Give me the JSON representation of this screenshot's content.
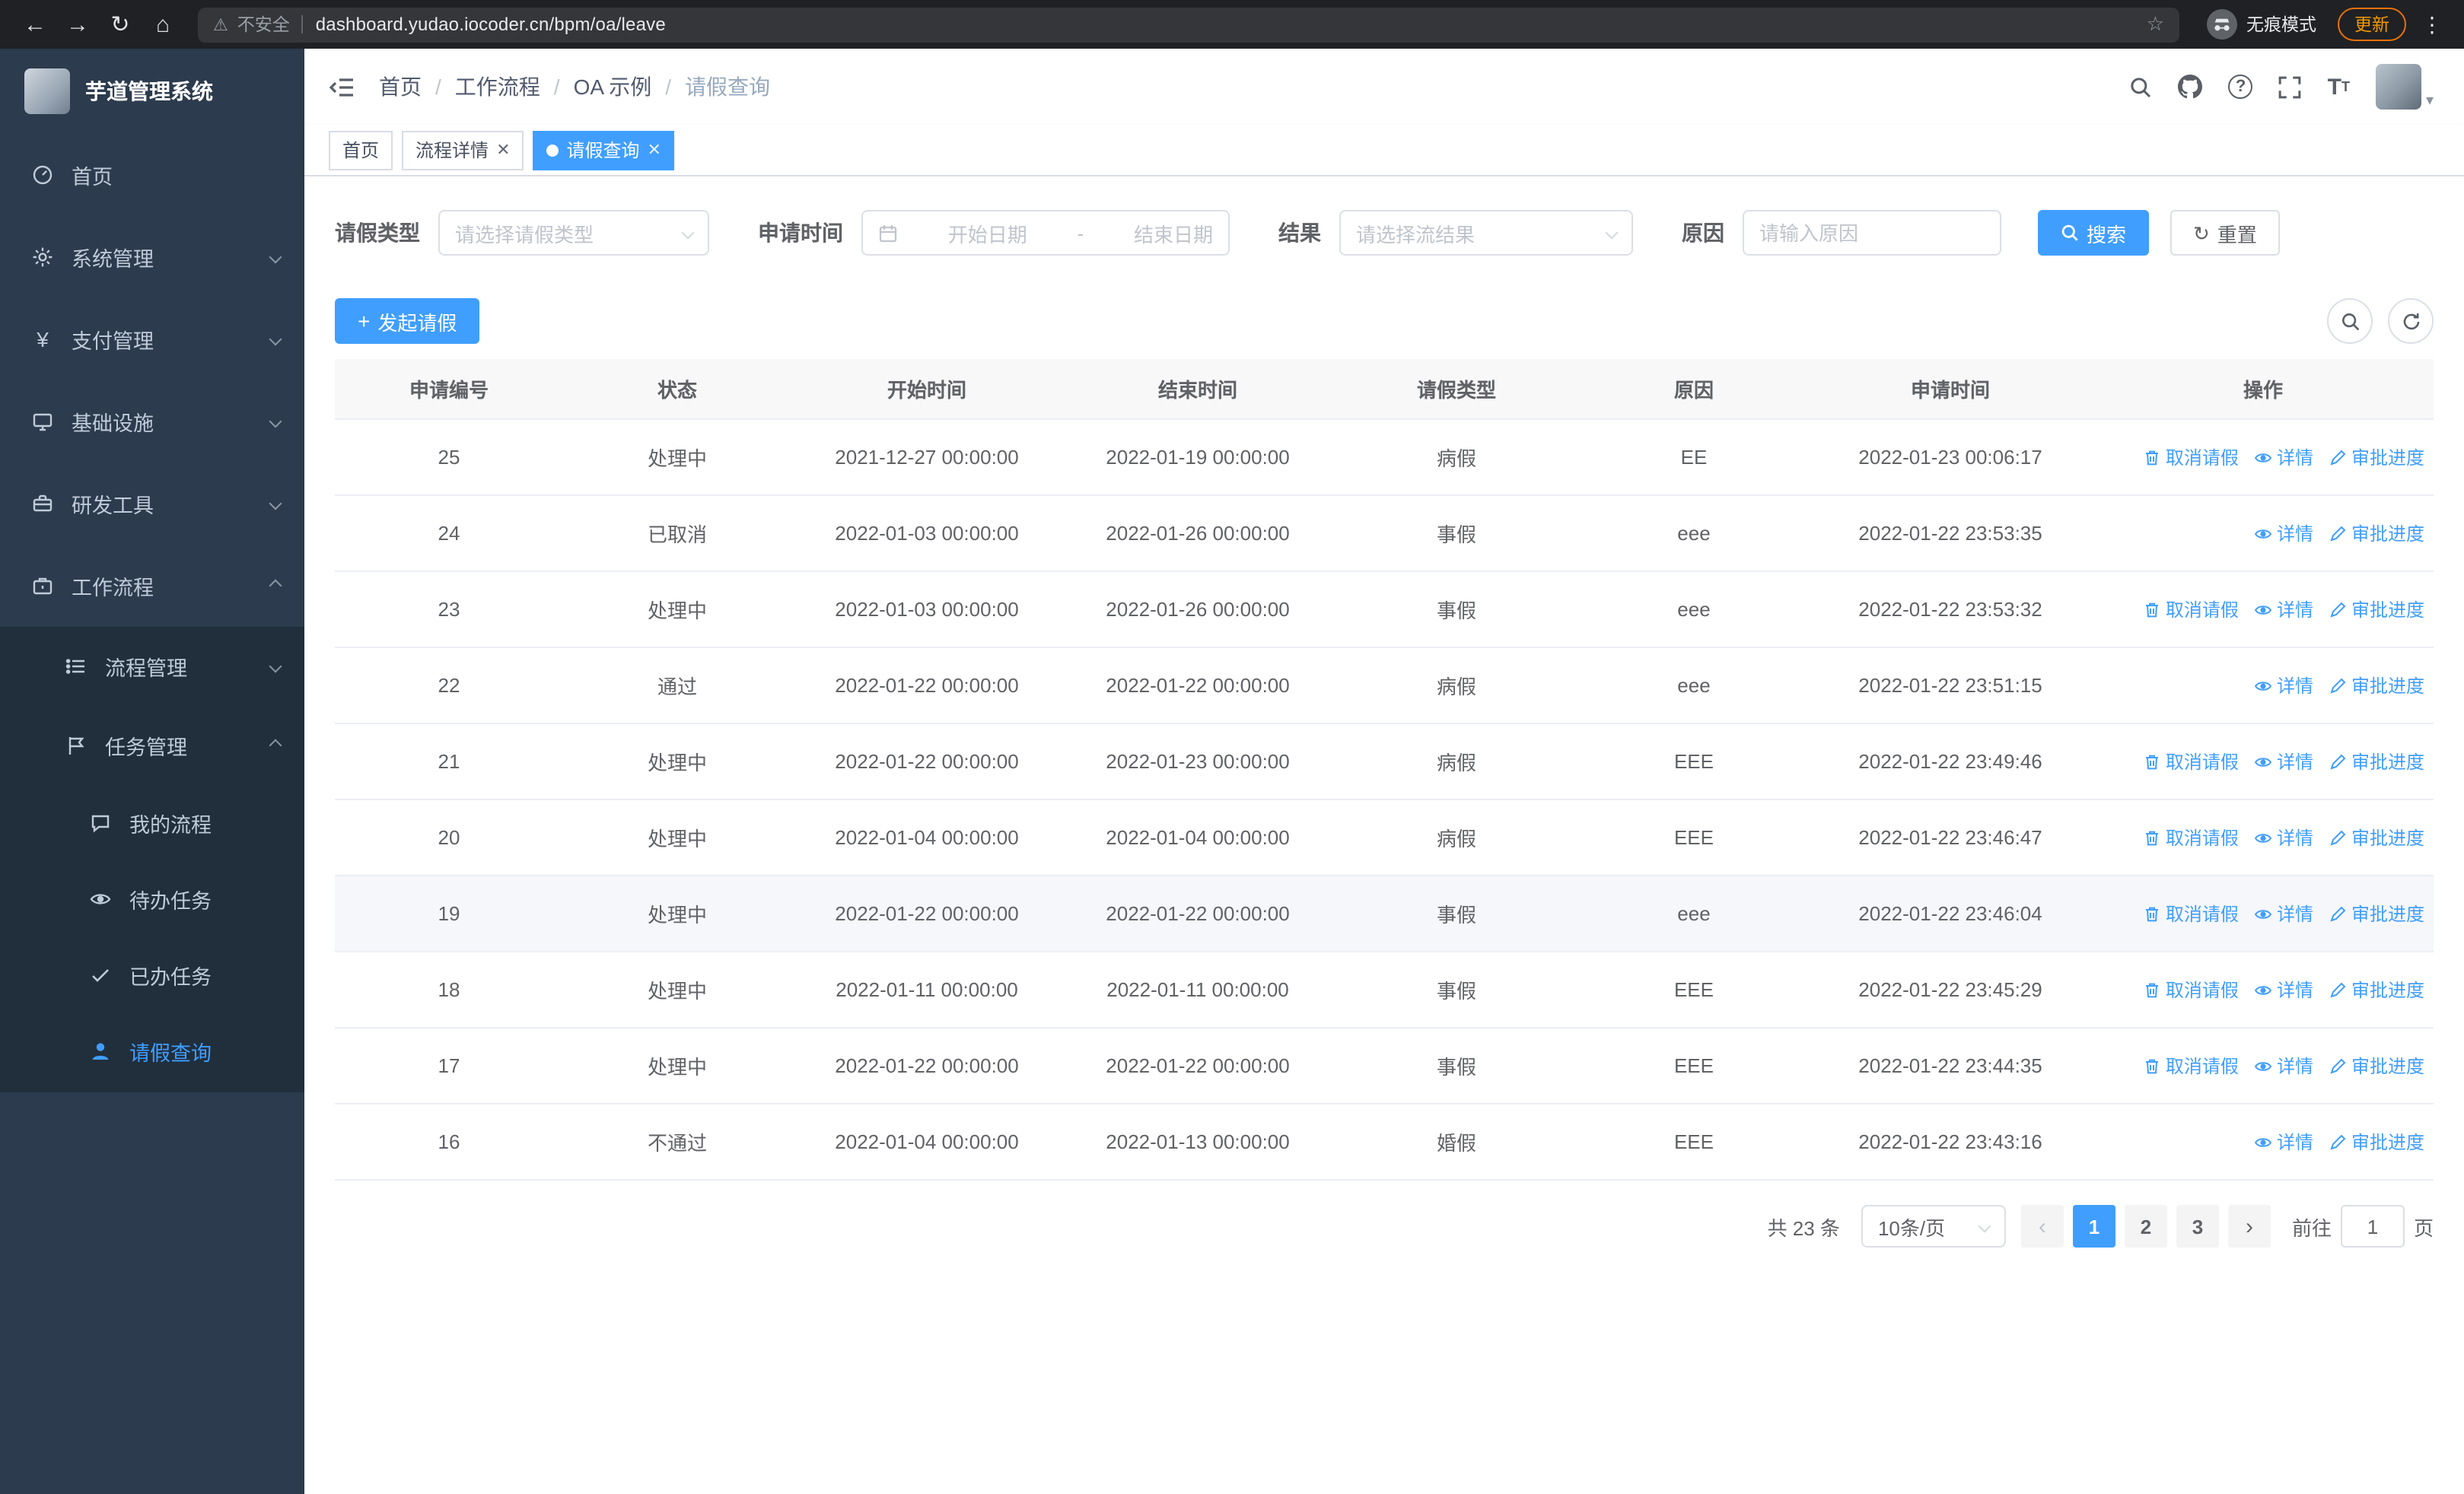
{
  "browser": {
    "security_label": "不安全",
    "url": "dashboard.yudao.iocoder.cn/bpm/oa/leave",
    "incognito_label": "无痕模式",
    "update_label": "更新"
  },
  "sidebar": {
    "logo_title": "芋道管理系统",
    "items": [
      {
        "label": "首页"
      },
      {
        "label": "系统管理"
      },
      {
        "label": "支付管理"
      },
      {
        "label": "基础设施"
      },
      {
        "label": "研发工具"
      },
      {
        "label": "工作流程"
      }
    ],
    "workflow_children": [
      {
        "label": "流程管理"
      },
      {
        "label": "任务管理"
      }
    ],
    "task_children": [
      {
        "label": "我的流程"
      },
      {
        "label": "待办任务"
      },
      {
        "label": "已办任务"
      },
      {
        "label": "请假查询"
      }
    ]
  },
  "header": {
    "breadcrumb": [
      "首页",
      "工作流程",
      "OA 示例",
      "请假查询"
    ]
  },
  "tabs": [
    {
      "label": "首页"
    },
    {
      "label": "流程详情"
    },
    {
      "label": "请假查询"
    }
  ],
  "filters": {
    "leave_type_label": "请假类型",
    "leave_type_placeholder": "请选择请假类型",
    "apply_time_label": "申请时间",
    "start_date_placeholder": "开始日期",
    "range_separator": "-",
    "end_date_placeholder": "结束日期",
    "result_label": "结果",
    "result_placeholder": "请选择流结果",
    "reason_label": "原因",
    "reason_placeholder": "请输入原因",
    "search_label": "搜索",
    "reset_label": "重置"
  },
  "toolbar": {
    "create_label": "发起请假"
  },
  "table": {
    "columns": [
      "申请编号",
      "状态",
      "开始时间",
      "结束时间",
      "请假类型",
      "原因",
      "申请时间",
      "操作"
    ],
    "action_labels": {
      "cancel": "取消请假",
      "detail": "详情",
      "progress": "审批进度"
    },
    "rows": [
      {
        "id": "25",
        "status": "处理中",
        "start": "2021-12-27 00:00:00",
        "end": "2022-01-19 00:00:00",
        "type": "病假",
        "reason": "EE",
        "applied": "2022-01-23 00:06:17",
        "actions": [
          "cancel",
          "detail",
          "progress"
        ],
        "highlighted": false
      },
      {
        "id": "24",
        "status": "已取消",
        "start": "2022-01-03 00:00:00",
        "end": "2022-01-26 00:00:00",
        "type": "事假",
        "reason": "eee",
        "applied": "2022-01-22 23:53:35",
        "actions": [
          "detail",
          "progress"
        ],
        "highlighted": false
      },
      {
        "id": "23",
        "status": "处理中",
        "start": "2022-01-03 00:00:00",
        "end": "2022-01-26 00:00:00",
        "type": "事假",
        "reason": "eee",
        "applied": "2022-01-22 23:53:32",
        "actions": [
          "cancel",
          "detail",
          "progress"
        ],
        "highlighted": false
      },
      {
        "id": "22",
        "status": "通过",
        "start": "2022-01-22 00:00:00",
        "end": "2022-01-22 00:00:00",
        "type": "病假",
        "reason": "eee",
        "applied": "2022-01-22 23:51:15",
        "actions": [
          "detail",
          "progress"
        ],
        "highlighted": false
      },
      {
        "id": "21",
        "status": "处理中",
        "start": "2022-01-22 00:00:00",
        "end": "2022-01-23 00:00:00",
        "type": "病假",
        "reason": "EEE",
        "applied": "2022-01-22 23:49:46",
        "actions": [
          "cancel",
          "detail",
          "progress"
        ],
        "highlighted": false
      },
      {
        "id": "20",
        "status": "处理中",
        "start": "2022-01-04 00:00:00",
        "end": "2022-01-04 00:00:00",
        "type": "病假",
        "reason": "EEE",
        "applied": "2022-01-22 23:46:47",
        "actions": [
          "cancel",
          "detail",
          "progress"
        ],
        "highlighted": false
      },
      {
        "id": "19",
        "status": "处理中",
        "start": "2022-01-22 00:00:00",
        "end": "2022-01-22 00:00:00",
        "type": "事假",
        "reason": "eee",
        "applied": "2022-01-22 23:46:04",
        "actions": [
          "cancel",
          "detail",
          "progress"
        ],
        "highlighted": true
      },
      {
        "id": "18",
        "status": "处理中",
        "start": "2022-01-11 00:00:00",
        "end": "2022-01-11 00:00:00",
        "type": "事假",
        "reason": "EEE",
        "applied": "2022-01-22 23:45:29",
        "actions": [
          "cancel",
          "detail",
          "progress"
        ],
        "highlighted": false
      },
      {
        "id": "17",
        "status": "处理中",
        "start": "2022-01-22 00:00:00",
        "end": "2022-01-22 00:00:00",
        "type": "事假",
        "reason": "EEE",
        "applied": "2022-01-22 23:44:35",
        "actions": [
          "cancel",
          "detail",
          "progress"
        ],
        "highlighted": false
      },
      {
        "id": "16",
        "status": "不通过",
        "start": "2022-01-04 00:00:00",
        "end": "2022-01-13 00:00:00",
        "type": "婚假",
        "reason": "EEE",
        "applied": "2022-01-22 23:43:16",
        "actions": [
          "detail",
          "progress"
        ],
        "highlighted": false
      }
    ]
  },
  "pagination": {
    "total_label": "共 23 条",
    "page_size": "10条/页",
    "pages": [
      "1",
      "2",
      "3"
    ],
    "goto_label": "前往",
    "goto_value": "1",
    "page_suffix": "页"
  }
}
